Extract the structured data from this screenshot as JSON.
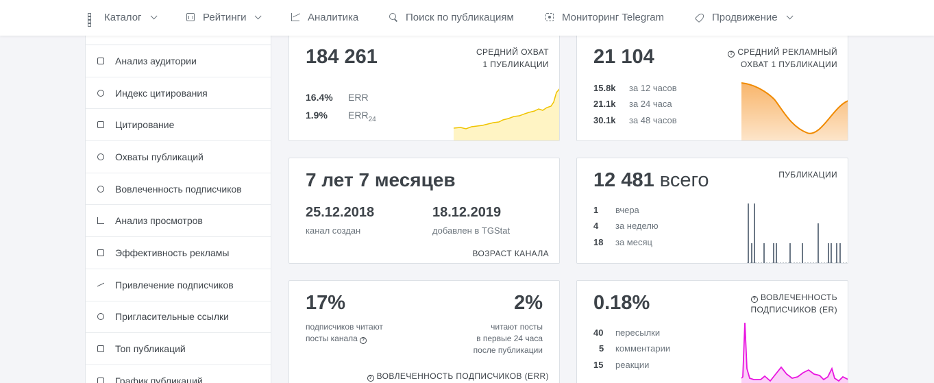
{
  "nav": [
    {
      "label": "Каталог",
      "icon": "grid-icon",
      "dropdown": true
    },
    {
      "label": "Рейтинги",
      "icon": "rating-icon",
      "dropdown": true
    },
    {
      "label": "Аналитика",
      "icon": "chart-line-icon",
      "dropdown": false
    },
    {
      "label": "Поиск по публикациям",
      "icon": "search-icon",
      "dropdown": false
    },
    {
      "label": "Мониторинг Telegram",
      "icon": "monitor-icon",
      "dropdown": false
    },
    {
      "label": "Продвижение",
      "icon": "rocket-icon",
      "dropdown": true
    }
  ],
  "sidebar": [
    {
      "label": "Анализ аудитории",
      "icon": "hourglass-icon"
    },
    {
      "label": "Индекс цитирования",
      "icon": "at-icon"
    },
    {
      "label": "Цитирование",
      "icon": "quote-icon"
    },
    {
      "label": "Охваты публикаций",
      "icon": "eye-icon"
    },
    {
      "label": "Вовлеченность подписчиков",
      "icon": "heart-icon"
    },
    {
      "label": "Анализ просмотров",
      "icon": "bar-chart-icon"
    },
    {
      "label": "Эффективность рекламы",
      "icon": "rocket-icon"
    },
    {
      "label": "Привлечение подписчиков",
      "icon": "trend-icon"
    },
    {
      "label": "Пригласительные ссылки",
      "icon": "link-icon"
    },
    {
      "label": "Топ публикаций",
      "icon": "thumbs-up-icon"
    },
    {
      "label": "График публикаций",
      "icon": "calendar-icon"
    }
  ],
  "reach": {
    "value": "184 261",
    "caption1": "СРЕДНИЙ ОХВАТ",
    "caption2": "1 ПУБЛИКАЦИИ",
    "err_value": "16.4%",
    "err_label": "ERR",
    "err24_value": "1.9%",
    "err24_label": "ERR",
    "err24_sub": "24",
    "color": "#f0c400"
  },
  "ad_reach": {
    "value": "21 104",
    "caption1": "СРЕДНИЙ РЕКЛАМНЫЙ",
    "caption2": "ОХВАТ 1 ПУБЛИКАЦИИ",
    "rows": [
      {
        "value": "15.8k",
        "label": "за 12 часов"
      },
      {
        "value": "21.1k",
        "label": "за 24 часа"
      },
      {
        "value": "30.1k",
        "label": "за 48 часов"
      }
    ],
    "color": "#f08a00"
  },
  "age": {
    "value": "7 лет 7 месяцев",
    "created_date": "25.12.2018",
    "created_label": "канал создан",
    "added_date": "18.12.2019",
    "added_label": "добавлен в TGStat",
    "caption": "ВОЗРАСТ КАНАЛА"
  },
  "posts": {
    "value": "12 481",
    "value_suffix": "всего",
    "caption": "ПУБЛИКАЦИИ",
    "rows": [
      {
        "value": "1",
        "label": "вчера"
      },
      {
        "value": "4",
        "label": "за неделю"
      },
      {
        "value": "18",
        "label": "за месяц"
      }
    ],
    "color": "#6b7785"
  },
  "err": {
    "left_value": "17%",
    "left_text1": "подписчиков читают",
    "left_text2": "посты канала",
    "right_value": "2%",
    "right_text1": "читают посты",
    "right_text2": "в первые 24 часа",
    "right_text3": "после публикации",
    "caption": "ВОВЛЕЧЕННОСТЬ ПОДПИСЧИКОВ (ERR)"
  },
  "er": {
    "value": "0.18%",
    "caption1": "ВОВЛЕЧЕННОСТЬ",
    "caption2": "ПОДПИСЧИКОВ (ER)",
    "rows": [
      {
        "value": "40",
        "label": "пересылки"
      },
      {
        "value": "5",
        "label": "комментарии"
      },
      {
        "value": "15",
        "label": "реакции"
      }
    ],
    "color": "#e815e0"
  }
}
